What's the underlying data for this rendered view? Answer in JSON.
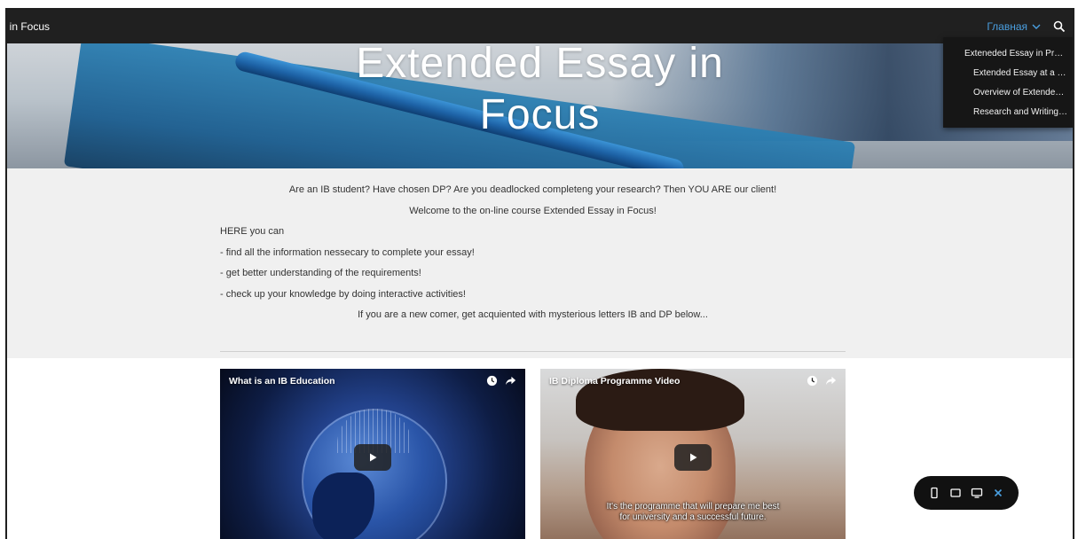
{
  "header": {
    "site_title": ". in Focus",
    "nav_home": "Главная"
  },
  "dropdown": {
    "items": [
      "Exteneded Essay in Practi...",
      "Extended Essay at a Gla...",
      "Overview of Extended ...",
      "Research and Writing P..."
    ]
  },
  "hero": {
    "title_line1": "Extended Essay in",
    "title_line2": "Focus"
  },
  "intro": {
    "line1": "Are an IB student? Have chosen DP? Are you deadlocked completeng your research? Then YOU ARE our client!",
    "line2": "Welcome to the on-line course Extended Essay in Focus!",
    "line3": "HERE you can",
    "line4": "- find all the information nessecary to complete your essay!",
    "line5": "- get better understanding of the requirements!",
    "line6": "- check up your knowledge by doing interactive activities!",
    "line7": "If you are a new comer, get acquiented with mysterious letters IB and DP below..."
  },
  "videos": [
    {
      "title": "What is an IB Education",
      "subtitle": ""
    },
    {
      "title": "IB Diploma Programme Video",
      "subtitle_line1": "It's the programme that will prepare me best",
      "subtitle_line2": "for university and a successful future."
    }
  ],
  "colors": {
    "topbar": "#202020",
    "nav_accent": "#4a9fe0",
    "intro_bg": "#f0f0f0",
    "device_bar_accent": "#4a9fe0"
  },
  "icons": {
    "search": "search-icon",
    "chevron": "chevron-down-icon",
    "watch_later": "clock-icon",
    "share": "share-icon",
    "play": "play-icon",
    "phone": "phone-icon",
    "tablet": "tablet-icon",
    "desktop": "desktop-icon",
    "close": "close-icon"
  }
}
